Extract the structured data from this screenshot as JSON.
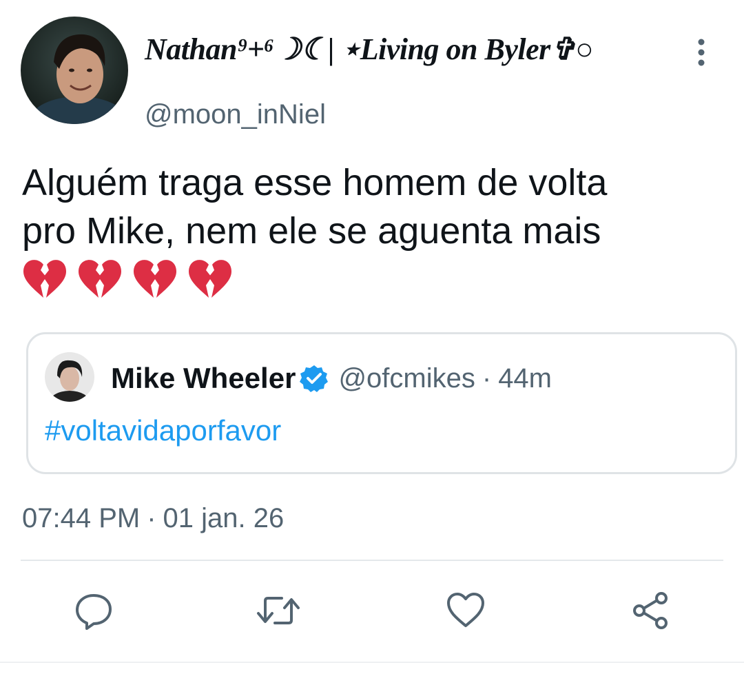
{
  "tweet": {
    "author": {
      "display_name": "Nathan⁹+⁶☽☾| ⋆Living on Byler✞○",
      "handle": "@moon_inNiel",
      "avatar": "avatar-photo"
    },
    "text_line1": "Alguém traga esse homem de volta",
    "text_line2": "pro Mike, nem ele se aguenta mais",
    "emojis": [
      "broken-heart-icon",
      "broken-heart-icon",
      "broken-heart-icon",
      "broken-heart-icon"
    ],
    "quoted": {
      "display_name": "Mike Wheeler",
      "verified": true,
      "handle": "@ofcmikes",
      "separator": "·",
      "time": "44m",
      "text": "#voltavidaporfavor"
    },
    "time": "07:44 PM",
    "separator": "·",
    "date": "01 jan. 26"
  },
  "actions": [
    "reply-icon",
    "retweet-icon",
    "like-icon",
    "share-icon"
  ],
  "colors": {
    "text": "#0f1419",
    "secondary": "#536471",
    "link": "#1d9bf0",
    "border": "#dfe3e6",
    "heart_red": "#dd2e44"
  }
}
